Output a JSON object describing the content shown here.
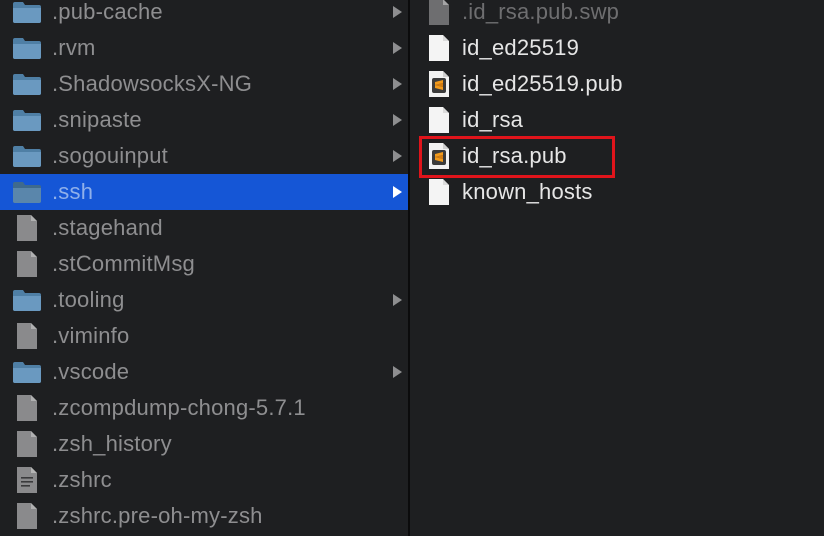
{
  "left_column": {
    "items": [
      {
        "label": ".pub-cache",
        "icon": "folder-icon",
        "has_children": true,
        "selected": false
      },
      {
        "label": ".rvm",
        "icon": "folder-icon",
        "has_children": true,
        "selected": false
      },
      {
        "label": ".ShadowsocksX-NG",
        "icon": "folder-icon",
        "has_children": true,
        "selected": false
      },
      {
        "label": ".snipaste",
        "icon": "folder-icon",
        "has_children": true,
        "selected": false
      },
      {
        "label": ".sogouinput",
        "icon": "folder-icon",
        "has_children": true,
        "selected": false
      },
      {
        "label": ".ssh",
        "icon": "folder-icon",
        "has_children": true,
        "selected": true
      },
      {
        "label": ".stagehand",
        "icon": "file-icon",
        "has_children": false,
        "selected": false
      },
      {
        "label": ".stCommitMsg",
        "icon": "file-icon",
        "has_children": false,
        "selected": false
      },
      {
        "label": ".tooling",
        "icon": "folder-icon",
        "has_children": true,
        "selected": false
      },
      {
        "label": ".viminfo",
        "icon": "file-icon",
        "has_children": false,
        "selected": false
      },
      {
        "label": ".vscode",
        "icon": "folder-icon",
        "has_children": true,
        "selected": false
      },
      {
        "label": ".zcompdump-chong-5.7.1",
        "icon": "file-icon",
        "has_children": false,
        "selected": false
      },
      {
        "label": ".zsh_history",
        "icon": "file-icon",
        "has_children": false,
        "selected": false
      },
      {
        "label": ".zshrc",
        "icon": "text-file-icon",
        "has_children": false,
        "selected": false
      },
      {
        "label": ".zshrc.pre-oh-my-zsh",
        "icon": "file-icon",
        "has_children": false,
        "selected": false
      }
    ]
  },
  "right_column": {
    "items": [
      {
        "label": ".id_rsa.pub.swp",
        "icon": "file-icon",
        "dim": true
      },
      {
        "label": "id_ed25519",
        "icon": "file-icon",
        "dim": false
      },
      {
        "label": "id_ed25519.pub",
        "icon": "sublime-file-icon",
        "dim": false
      },
      {
        "label": "id_rsa",
        "icon": "file-icon",
        "dim": false
      },
      {
        "label": "id_rsa.pub",
        "icon": "sublime-file-icon",
        "dim": false,
        "highlighted": true
      },
      {
        "label": "known_hosts",
        "icon": "file-icon",
        "dim": false
      }
    ]
  },
  "colors": {
    "background": "#1e1f21",
    "selection": "#1556d6",
    "highlight_border": "#e0141b",
    "folder": "#4f7fa5",
    "sublime_orange": "#f29a1b"
  }
}
